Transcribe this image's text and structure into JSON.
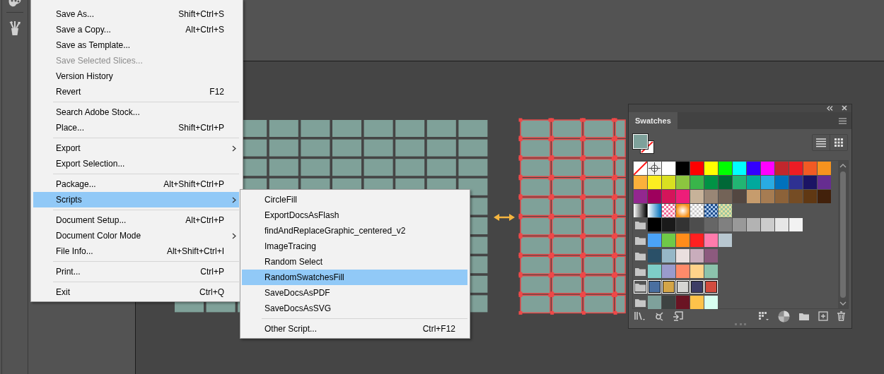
{
  "file_menu": {
    "items": [
      {
        "kind": "item",
        "label": "Save As...",
        "shortcut": "Shift+Ctrl+S",
        "disabled": false,
        "selected": false,
        "submenu": false
      },
      {
        "kind": "item",
        "label": "Save a Copy...",
        "shortcut": "Alt+Ctrl+S",
        "disabled": false,
        "selected": false,
        "submenu": false
      },
      {
        "kind": "item",
        "label": "Save as Template...",
        "disabled": false,
        "selected": false,
        "submenu": false
      },
      {
        "kind": "item",
        "label": "Save Selected Slices...",
        "disabled": true,
        "selected": false,
        "submenu": false
      },
      {
        "kind": "item",
        "label": "Version History",
        "disabled": false,
        "selected": false,
        "submenu": false
      },
      {
        "kind": "item",
        "label": "Revert",
        "shortcut": "F12",
        "disabled": false,
        "selected": false,
        "submenu": false
      },
      {
        "kind": "separator"
      },
      {
        "kind": "item",
        "label": "Search Adobe Stock...",
        "disabled": false,
        "selected": false,
        "submenu": false
      },
      {
        "kind": "item",
        "label": "Place...",
        "shortcut": "Shift+Ctrl+P",
        "disabled": false,
        "selected": false,
        "submenu": false
      },
      {
        "kind": "separator"
      },
      {
        "kind": "item",
        "label": "Export",
        "disabled": false,
        "selected": false,
        "submenu": true
      },
      {
        "kind": "item",
        "label": "Export Selection...",
        "disabled": false,
        "selected": false,
        "submenu": false
      },
      {
        "kind": "separator"
      },
      {
        "kind": "item",
        "label": "Package...",
        "shortcut": "Alt+Shift+Ctrl+P",
        "disabled": false,
        "selected": false,
        "submenu": false
      },
      {
        "kind": "item",
        "label": "Scripts",
        "disabled": false,
        "selected": true,
        "submenu": true
      },
      {
        "kind": "separator"
      },
      {
        "kind": "item",
        "label": "Document Setup...",
        "shortcut": "Alt+Ctrl+P",
        "disabled": false,
        "selected": false,
        "submenu": false
      },
      {
        "kind": "item",
        "label": "Document Color Mode",
        "disabled": false,
        "selected": false,
        "submenu": true
      },
      {
        "kind": "item",
        "label": "File Info...",
        "shortcut": "Alt+Shift+Ctrl+I",
        "disabled": false,
        "selected": false,
        "submenu": false
      },
      {
        "kind": "separator"
      },
      {
        "kind": "item",
        "label": "Print...",
        "shortcut": "Ctrl+P",
        "disabled": false,
        "selected": false,
        "submenu": false
      },
      {
        "kind": "separator"
      },
      {
        "kind": "item",
        "label": "Exit",
        "shortcut": "Ctrl+Q",
        "disabled": false,
        "selected": false,
        "submenu": false
      }
    ]
  },
  "scripts_menu": {
    "items": [
      {
        "kind": "item",
        "label": "CircleFill",
        "selected": false
      },
      {
        "kind": "item",
        "label": "ExportDocsAsFlash",
        "selected": false
      },
      {
        "kind": "item",
        "label": "findAndReplaceGraphic_centered_v2",
        "selected": false
      },
      {
        "kind": "item",
        "label": "ImageTracing",
        "selected": false
      },
      {
        "kind": "item",
        "label": "Random Select",
        "selected": false
      },
      {
        "kind": "item",
        "label": "RandomSwatchesFill",
        "selected": true
      },
      {
        "kind": "item",
        "label": "SaveDocsAsPDF",
        "selected": false
      },
      {
        "kind": "item",
        "label": "SaveDocsAsSVG",
        "selected": false
      },
      {
        "kind": "separator"
      },
      {
        "kind": "item",
        "label": "Other Script...",
        "shortcut": "Ctrl+F12",
        "selected": false
      }
    ]
  },
  "swatches_panel": {
    "tab": "Swatches",
    "fill": {
      "color": "#7ea19b"
    },
    "rows": [
      {
        "folder": false,
        "selected": false,
        "swatches": [
          {
            "kind": "none"
          },
          {
            "kind": "registration"
          },
          {
            "kind": "solid",
            "color": "#ffffff"
          },
          {
            "kind": "solid",
            "color": "#000000"
          },
          {
            "kind": "solid",
            "color": "#ff0000"
          },
          {
            "kind": "solid",
            "color": "#ffff00"
          },
          {
            "kind": "solid",
            "color": "#00ff00"
          },
          {
            "kind": "solid",
            "color": "#00ffff"
          },
          {
            "kind": "solid",
            "color": "#3300ff"
          },
          {
            "kind": "solid",
            "color": "#ff00ff"
          },
          {
            "kind": "solid",
            "color": "#c1272d"
          },
          {
            "kind": "solid",
            "color": "#ed1c24"
          },
          {
            "kind": "solid",
            "color": "#f15a24"
          },
          {
            "kind": "solid",
            "color": "#f7931e"
          }
        ]
      },
      {
        "folder": false,
        "selected": false,
        "swatches": [
          {
            "kind": "solid",
            "color": "#fbb03b"
          },
          {
            "kind": "solid",
            "color": "#fcee21"
          },
          {
            "kind": "solid",
            "color": "#d9e021"
          },
          {
            "kind": "solid",
            "color": "#8cc63f"
          },
          {
            "kind": "solid",
            "color": "#39b54a"
          },
          {
            "kind": "solid",
            "color": "#009245"
          },
          {
            "kind": "solid",
            "color": "#006837"
          },
          {
            "kind": "solid",
            "color": "#22b573"
          },
          {
            "kind": "solid",
            "color": "#00a99d"
          },
          {
            "kind": "solid",
            "color": "#29abe2"
          },
          {
            "kind": "solid",
            "color": "#0071bc"
          },
          {
            "kind": "solid",
            "color": "#2e3192"
          },
          {
            "kind": "solid",
            "color": "#1b1464"
          },
          {
            "kind": "solid",
            "color": "#662d91"
          }
        ]
      },
      {
        "folder": false,
        "selected": false,
        "swatches": [
          {
            "kind": "solid",
            "color": "#93278f"
          },
          {
            "kind": "solid",
            "color": "#9e005d"
          },
          {
            "kind": "solid",
            "color": "#d4145a"
          },
          {
            "kind": "solid",
            "color": "#ed1e79"
          },
          {
            "kind": "solid",
            "color": "#c7b299"
          },
          {
            "kind": "solid",
            "color": "#998675"
          },
          {
            "kind": "solid",
            "color": "#736357"
          },
          {
            "kind": "solid",
            "color": "#534741"
          },
          {
            "kind": "solid",
            "color": "#c69c6d"
          },
          {
            "kind": "solid",
            "color": "#a67c52"
          },
          {
            "kind": "solid",
            "color": "#8c6239"
          },
          {
            "kind": "solid",
            "color": "#754c24"
          },
          {
            "kind": "solid",
            "color": "#603813"
          },
          {
            "kind": "solid",
            "color": "#42210b"
          }
        ]
      },
      {
        "folder": false,
        "selected": false,
        "swatches": [
          {
            "kind": "gradient"
          },
          {
            "kind": "gradient"
          },
          {
            "kind": "pattern"
          },
          {
            "kind": "radial"
          },
          {
            "kind": "pattern"
          },
          {
            "kind": "pattern"
          },
          {
            "kind": "pattern"
          }
        ]
      },
      {
        "folder": true,
        "selected": false,
        "swatches": [
          {
            "kind": "solid",
            "color": "#000000"
          },
          {
            "kind": "solid",
            "color": "#1a1a1a"
          },
          {
            "kind": "solid",
            "color": "#333333"
          },
          {
            "kind": "solid",
            "color": "#4d4d4d"
          },
          {
            "kind": "solid",
            "color": "#666666"
          },
          {
            "kind": "solid",
            "color": "#808080"
          },
          {
            "kind": "solid",
            "color": "#999999"
          },
          {
            "kind": "solid",
            "color": "#b3b3b3"
          },
          {
            "kind": "solid",
            "color": "#cccccc"
          },
          {
            "kind": "solid",
            "color": "#e6e6e6"
          },
          {
            "kind": "solid",
            "color": "#f2f2f2"
          }
        ]
      },
      {
        "folder": true,
        "selected": false,
        "swatches": [
          {
            "kind": "solid",
            "color": "#4ba3f6"
          },
          {
            "kind": "solid",
            "color": "#6fc948"
          },
          {
            "kind": "solid",
            "color": "#ff8c1a"
          },
          {
            "kind": "solid",
            "color": "#ff2020"
          },
          {
            "kind": "solid",
            "color": "#ff7bac"
          },
          {
            "kind": "solid",
            "color": "#b8c7d0"
          }
        ]
      },
      {
        "folder": true,
        "selected": false,
        "swatches": [
          {
            "kind": "solid",
            "color": "#2a5068"
          },
          {
            "kind": "solid",
            "color": "#96b7c7"
          },
          {
            "kind": "solid",
            "color": "#eadfdf"
          },
          {
            "kind": "solid",
            "color": "#c9adbc"
          },
          {
            "kind": "solid",
            "color": "#8c5a7e"
          }
        ]
      },
      {
        "folder": true,
        "selected": false,
        "swatches": [
          {
            "kind": "solid",
            "color": "#7ecdc8"
          },
          {
            "kind": "solid",
            "color": "#9a9bcc"
          },
          {
            "kind": "solid",
            "color": "#ff8a6a"
          },
          {
            "kind": "solid",
            "color": "#ffd38a"
          },
          {
            "kind": "solid",
            "color": "#8cc3ac"
          }
        ]
      },
      {
        "folder": true,
        "selected": true,
        "swatches": [
          {
            "kind": "solid",
            "color": "#4a6fa0"
          },
          {
            "kind": "solid",
            "color": "#d4a547"
          },
          {
            "kind": "solid",
            "color": "#d5d5d3"
          },
          {
            "kind": "solid",
            "color": "#3d3d66"
          },
          {
            "kind": "solid",
            "color": "#d24c3f"
          }
        ]
      },
      {
        "folder": true,
        "selected": false,
        "swatches": [
          {
            "kind": "solid",
            "color": "#7ea19b"
          },
          {
            "kind": "solid",
            "color": "#3d4241"
          },
          {
            "kind": "solid",
            "color": "#6a1423"
          },
          {
            "kind": "solid",
            "color": "#fec24a"
          },
          {
            "kind": "solid",
            "color": "#d7fff0"
          }
        ]
      }
    ]
  }
}
